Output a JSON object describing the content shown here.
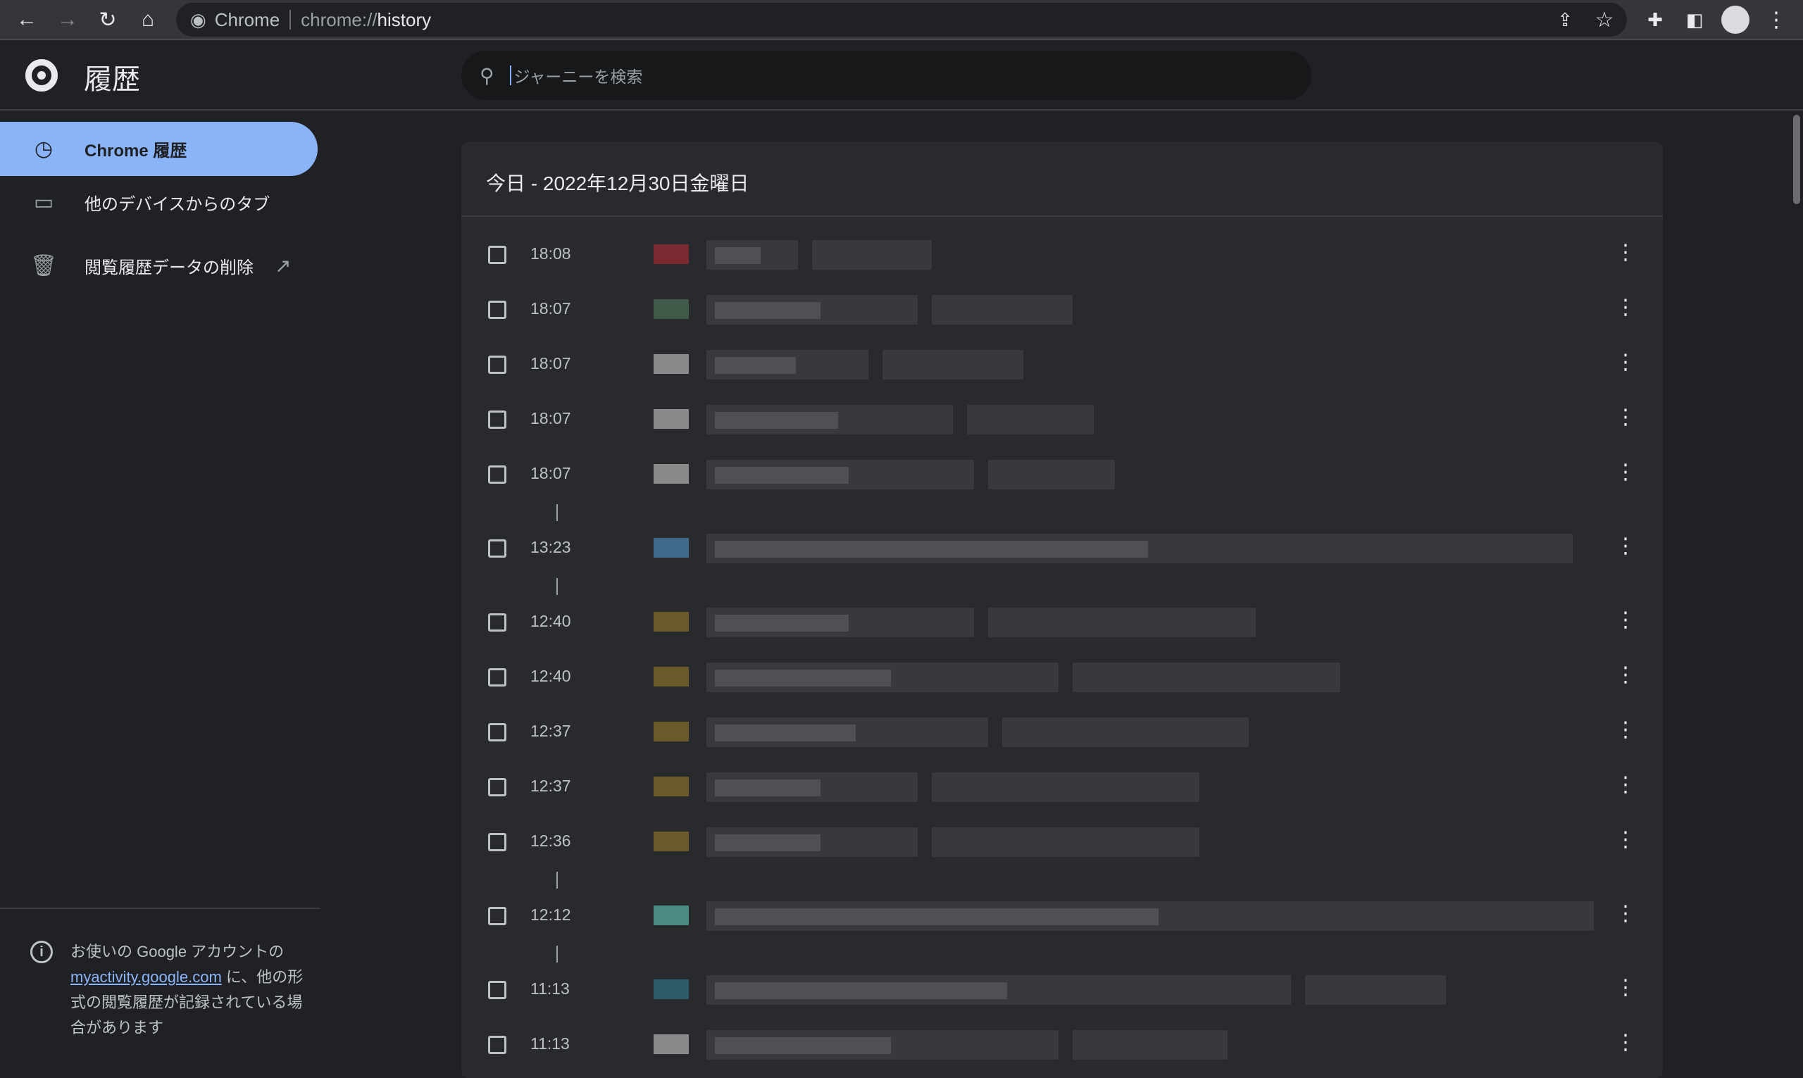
{
  "browser": {
    "omnibox_site": "Chrome",
    "omnibox_url_prefix": "chrome://",
    "omnibox_url_path": "history"
  },
  "header": {
    "title": "履歴",
    "search_placeholder": "ジャーニーを検索"
  },
  "sidebar": {
    "items": [
      {
        "label": "Chrome 履歴",
        "icon": "clock-icon",
        "active": true
      },
      {
        "label": "他のデバイスからのタブ",
        "icon": "devices-icon",
        "active": false
      },
      {
        "label": "閲覧履歴データの削除",
        "icon": "trash-icon",
        "active": false
      }
    ],
    "footer": {
      "text_before": "お使いの Google アカウントの ",
      "link": "myactivity.google.com",
      "text_after": " に、他の形式の閲覧履歴が記録されている場合があります"
    }
  },
  "main": {
    "day_title": "今日 - 2022年12月30日金曜日",
    "rows": [
      {
        "time": "18:08",
        "favicon": "#7a2a30"
      },
      {
        "time": "18:07",
        "favicon": "#3f5a48"
      },
      {
        "time": "18:07",
        "favicon": "#8a8a8a"
      },
      {
        "time": "18:07",
        "favicon": "#8a8a8a"
      },
      {
        "time": "18:07",
        "favicon": "#8a8a8a",
        "gap_after": true
      },
      {
        "time": "13:23",
        "favicon": "#3f6a8a",
        "gap_after": true
      },
      {
        "time": "12:40",
        "favicon": "#6a5a2a"
      },
      {
        "time": "12:40",
        "favicon": "#6a5a2a"
      },
      {
        "time": "12:37",
        "favicon": "#6a5a2a"
      },
      {
        "time": "12:37",
        "favicon": "#6a5a2a"
      },
      {
        "time": "12:36",
        "favicon": "#6a5a2a",
        "gap_after": true
      },
      {
        "time": "12:12",
        "favicon": "#4a8a80",
        "gap_after": true
      },
      {
        "time": "11:13",
        "favicon": "#2f5a6a"
      },
      {
        "time": "11:13",
        "favicon": "#8a8a8a"
      }
    ]
  },
  "colors": {
    "accent": "#8ab4f8",
    "background": "#202124",
    "card": "#292a2d"
  }
}
